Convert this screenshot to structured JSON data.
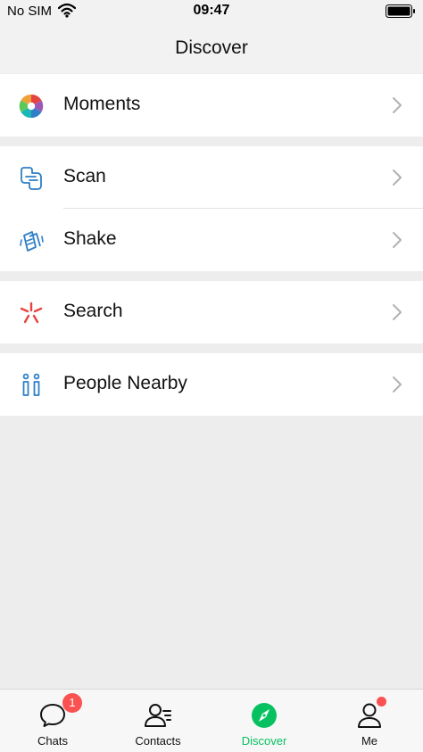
{
  "status_bar": {
    "carrier": "No SIM",
    "time": "09:47",
    "icons": [
      "wifi-icon",
      "battery-icon"
    ]
  },
  "nav": {
    "title": "Discover"
  },
  "sections": [
    {
      "items": [
        {
          "label": "Moments",
          "icon": "moments-icon"
        }
      ]
    },
    {
      "items": [
        {
          "label": "Scan",
          "icon": "scan-icon"
        },
        {
          "label": "Shake",
          "icon": "shake-icon"
        }
      ]
    },
    {
      "items": [
        {
          "label": "Search",
          "icon": "search-icon"
        }
      ]
    },
    {
      "items": [
        {
          "label": "People Nearby",
          "icon": "people-nearby-icon"
        }
      ]
    }
  ],
  "tabs": [
    {
      "label": "Chats",
      "icon": "chat-bubble-icon",
      "badge": "1"
    },
    {
      "label": "Contacts",
      "icon": "contacts-icon"
    },
    {
      "label": "Discover",
      "icon": "compass-icon",
      "active": true
    },
    {
      "label": "Me",
      "icon": "person-icon",
      "dot": true
    }
  ],
  "colors": {
    "accent": "#07c160",
    "badge": "#fa5151",
    "background": "#ededed",
    "icon_blue": "#2f7fc7",
    "search_red": "#e64340"
  }
}
